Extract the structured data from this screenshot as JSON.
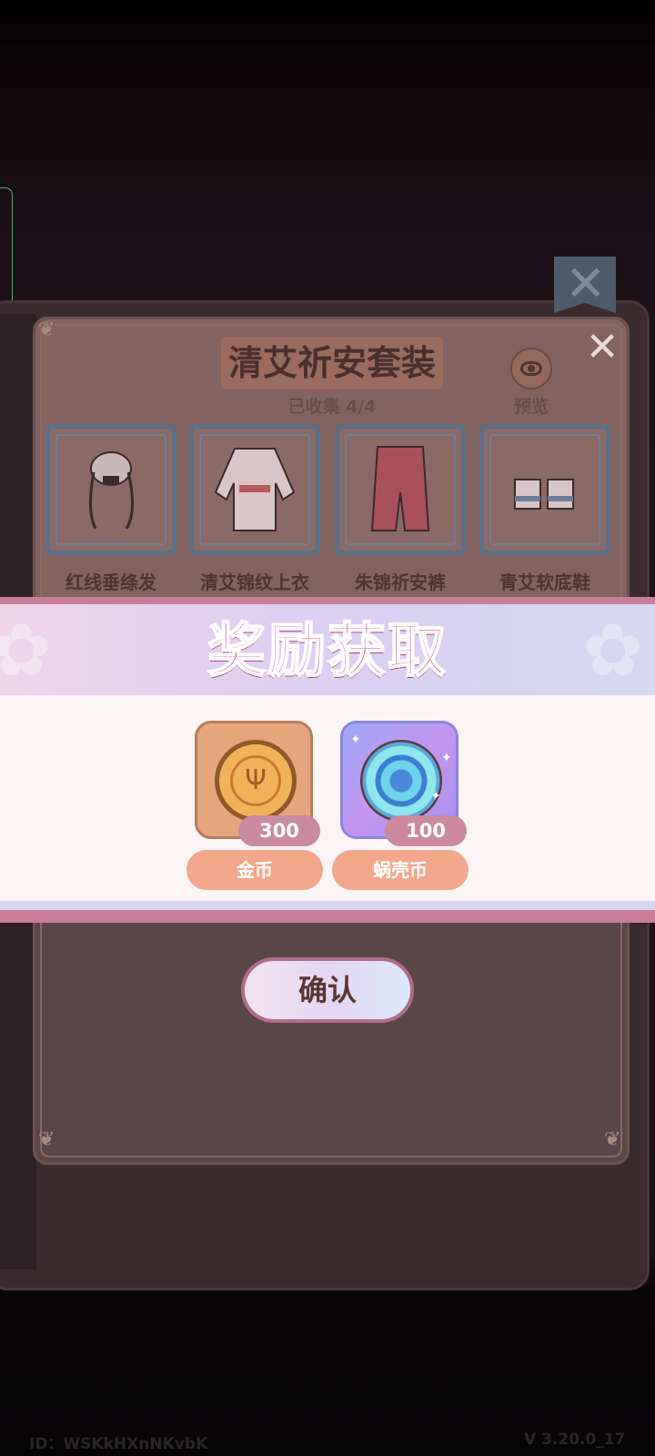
{
  "suit": {
    "title": "清艾祈安套装",
    "collected": "已收集 4/4",
    "preview_label": "预览",
    "items": [
      {
        "name": "红线垂绦发",
        "icon": "hair-icon"
      },
      {
        "name": "清艾锦纹上衣",
        "icon": "jacket-icon"
      },
      {
        "name": "朱锦祈安裤",
        "icon": "pants-icon"
      },
      {
        "name": "青艾软底鞋",
        "icon": "shoes-icon"
      }
    ]
  },
  "reward": {
    "title": "奖励获取",
    "items": [
      {
        "name": "金币",
        "count": "300",
        "icon": "gold-coin-icon"
      },
      {
        "name": "蜗壳币",
        "count": "100",
        "icon": "snail-shell-coin-icon"
      }
    ],
    "confirm_label": "确认"
  },
  "footer": {
    "id_text": "ID：WSKkHXnNKvbK",
    "version_text": "V 3.20.0_17"
  },
  "colors": {
    "reward_title": "#d3507e",
    "ribbon_border": "#c87d99",
    "reward_label_bg": "#f3a88c",
    "count_pill_bg": "#c98aa0"
  }
}
